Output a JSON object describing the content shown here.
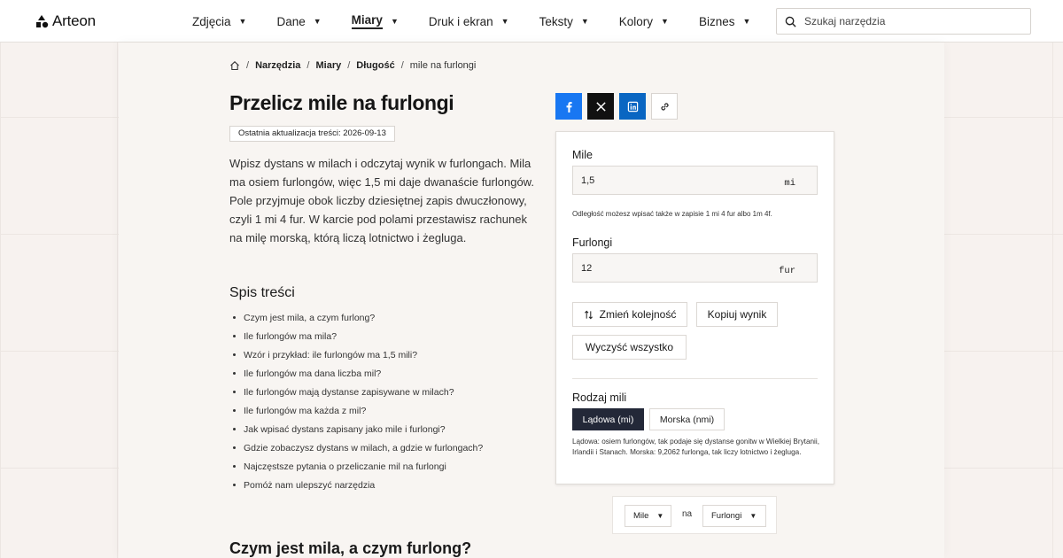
{
  "brand": {
    "name": "Arteon"
  },
  "nav": {
    "items": [
      {
        "label": "Zdjęcia"
      },
      {
        "label": "Dane"
      },
      {
        "label": "Miary",
        "active": true
      },
      {
        "label": "Druk i ekran"
      },
      {
        "label": "Teksty"
      },
      {
        "label": "Kolory"
      },
      {
        "label": "Biznes"
      }
    ]
  },
  "search": {
    "placeholder": "Szukaj narzędzia"
  },
  "breadcrumb": {
    "items": [
      "Narzędzia",
      "Miary",
      "Długość"
    ],
    "current": "mile na furlongi"
  },
  "page": {
    "title": "Przelicz mile na furlongi",
    "updated": "Ostatnia aktualizacja treści: 2026-09-13",
    "intro": "Wpisz dystans w milach i odczytaj wynik w furlongach. Mila ma osiem furlongów, więc 1,5 mi daje dwanaście furlongów. Pole przyjmuje obok liczby dziesiętnej zapis dwuczłonowy, czyli 1 mi 4 fur. W karcie pod polami przestawisz rachunek na milę morską, którą liczą lotnictwo i żegluga."
  },
  "toc": {
    "title": "Spis treści",
    "items": [
      "Czym jest mila, a czym furlong?",
      "Ile furlongów ma mila?",
      "Wzór i przykład: ile furlongów ma 1,5 mili?",
      "Ile furlongów ma dana liczba mil?",
      "Ile furlongów mają dystanse zapisywane w milach?",
      "Ile furlongów ma każda z mil?",
      "Jak wpisać dystans zapisany jako mile i furlongi?",
      "Gdzie zobaczysz dystans w milach, a gdzie w furlongach?",
      "Najczęstsze pytania o przeliczanie mil na furlongi",
      "Pomóż nam ulepszyć narzędzia"
    ]
  },
  "section": {
    "title": "Czym jest mila, a czym furlong?"
  },
  "share": {
    "icons": [
      "facebook-icon",
      "x-icon",
      "linkedin-icon",
      "link-icon"
    ],
    "colors": {
      "facebook": "#1877f2",
      "x": "#111111",
      "linkedin": "#0a66c2"
    }
  },
  "converter": {
    "from": {
      "label": "Mile",
      "value": "1,5",
      "unit": "mi"
    },
    "hint": "Odległość możesz wpisać także w zapisie 1 mi 4 fur albo 1m 4f.",
    "to": {
      "label": "Furlongi",
      "value": "12",
      "unit": "fur"
    },
    "buttons": {
      "swap": "Zmień kolejność",
      "copy": "Kopiuj wynik",
      "clear": "Wyczyść wszystko"
    },
    "mile_type": {
      "label": "Rodzaj mili",
      "options": [
        "Lądowa (mi)",
        "Morska (nmi)"
      ],
      "selected": "Lądowa (mi)",
      "description": "Lądowa: osiem furlongów, tak podaje się dystanse gonitw w Wielkiej Brytanii, Irlandii i Stanach. Morska: 9,2062 furlonga, tak liczy lotnictwo i żegluga."
    }
  },
  "picker": {
    "from": "Mile",
    "connector": "na",
    "to": "Furlongi"
  },
  "colors": {
    "accent_dark": "#232838",
    "page_bg": "#f7f2ef"
  }
}
